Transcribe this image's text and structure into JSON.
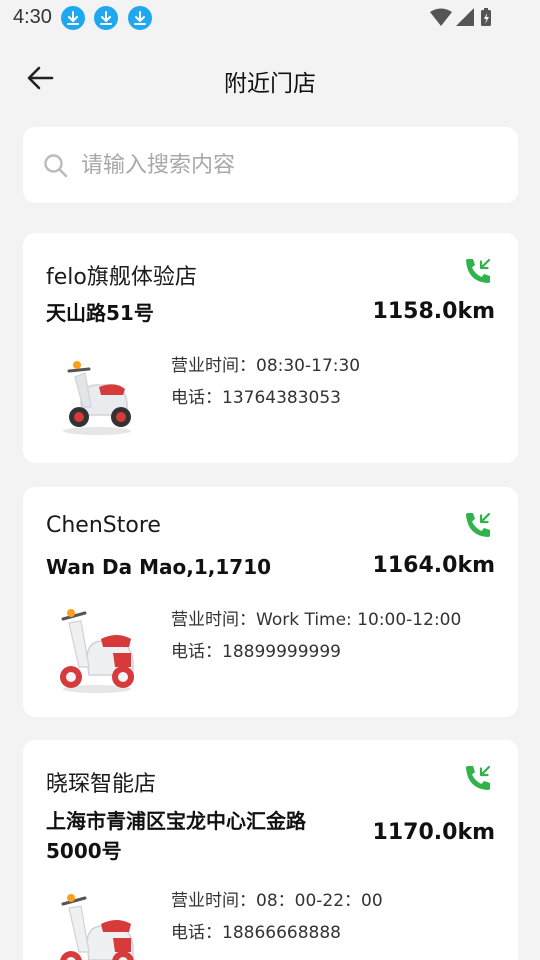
{
  "status_bar": {
    "time": "4:30",
    "download_icons": 3
  },
  "header": {
    "title": "附近门店"
  },
  "search": {
    "placeholder": "请输入搜索内容",
    "value": ""
  },
  "labels": {
    "hours_prefix": "营业时间：",
    "phone_prefix": "电话："
  },
  "stores": [
    {
      "name": "felo旗舰体验店",
      "address": "天山路51号",
      "distance": "1158.0km",
      "hours": "营业时间：08:30-17:30",
      "phone": "电话：13764383053"
    },
    {
      "name": "ChenStore",
      "address": "Wan Da Mao,1,1710",
      "distance": "1164.0km",
      "hours": "营业时间：Work Time: 10:00-12:00",
      "phone": "电话：18899999999"
    },
    {
      "name": "晓琛智能店",
      "address": "上海市青浦区宝龙中心汇金路5000号",
      "distance": "1170.0km",
      "hours": "营业时间：08：00-22：00",
      "phone": "电话：18866668888"
    }
  ],
  "colors": {
    "accent_green": "#2fb34a",
    "download_blue": "#1fa8f0",
    "background": "#f3f3f4"
  }
}
